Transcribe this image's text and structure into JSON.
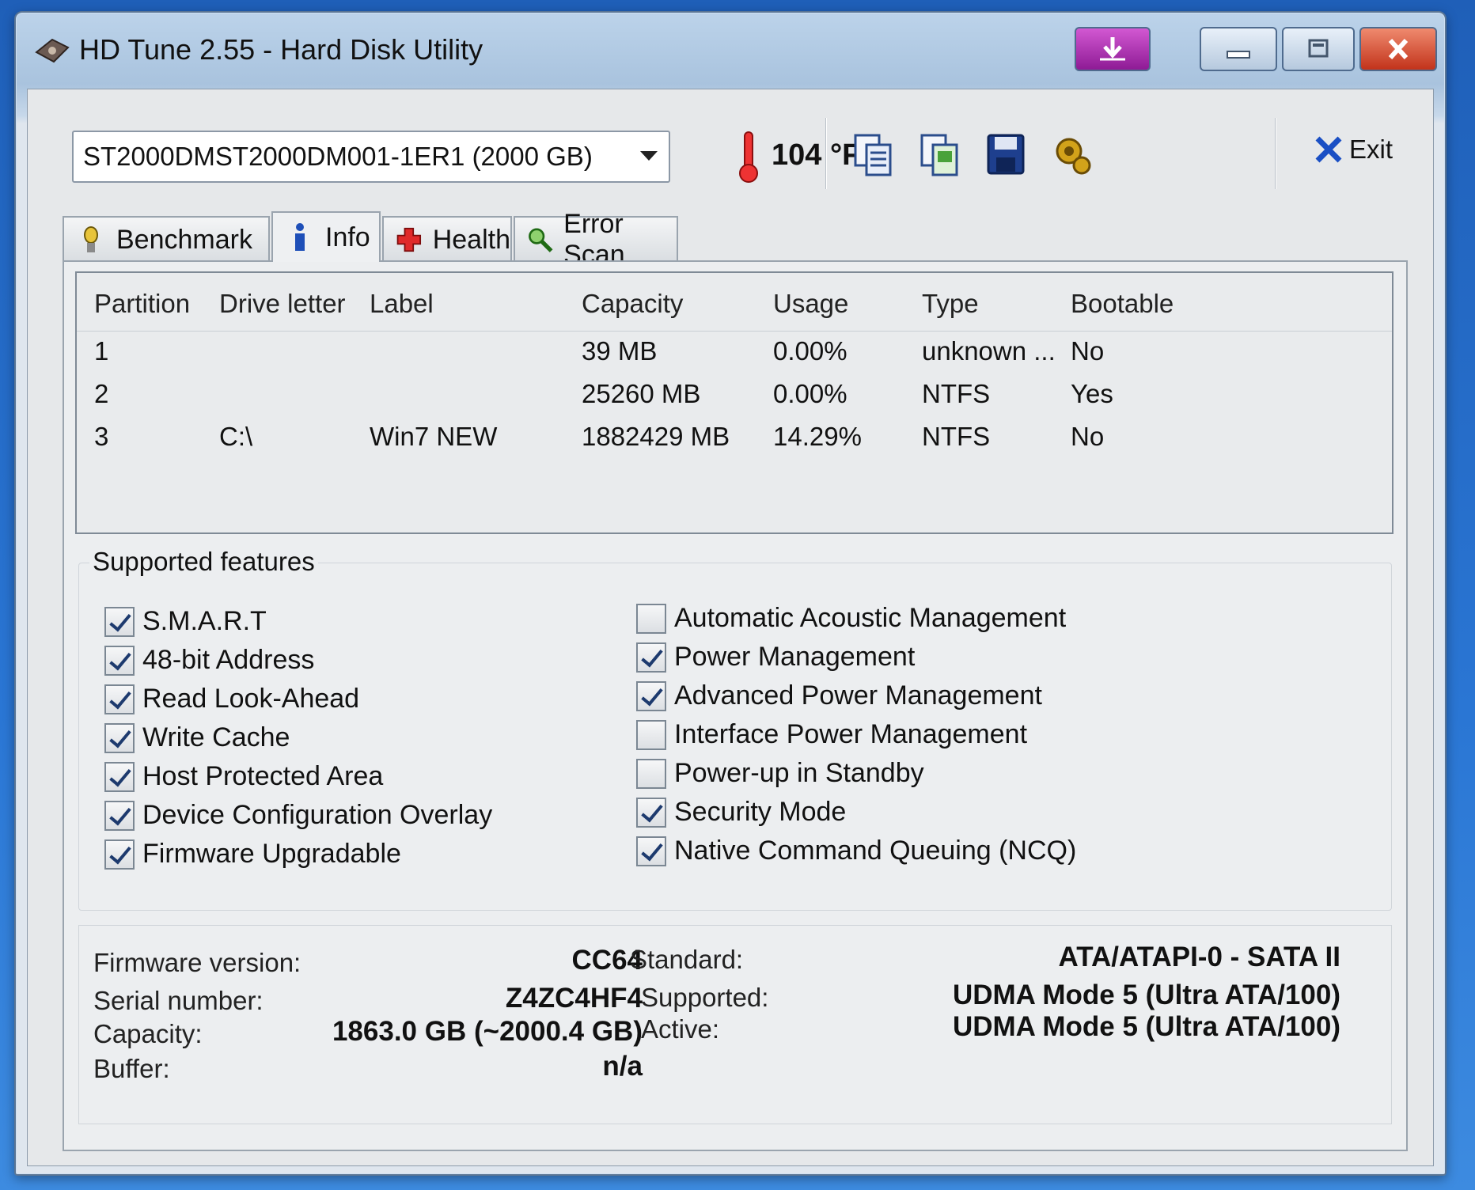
{
  "window": {
    "title": "HD Tune 2.55 - Hard Disk Utility",
    "colors": {
      "close": "#c2331b",
      "download": "#a42aa8",
      "accent": "#1d3a6e"
    }
  },
  "toolbar": {
    "drive": "ST2000DMST2000DM001-1ER1 (2000 GB)",
    "temperature": "104 °F",
    "icons": [
      "copy-text-icon",
      "copy-screenshot-icon",
      "save-icon",
      "options-icon"
    ],
    "exit_label": "Exit"
  },
  "tabs": [
    {
      "label": "Benchmark",
      "icon": "benchmark-icon",
      "active": false
    },
    {
      "label": "Info",
      "icon": "info-icon",
      "active": true
    },
    {
      "label": "Health",
      "icon": "health-icon",
      "active": false
    },
    {
      "label": "Error Scan",
      "icon": "magnifier-icon",
      "active": false
    }
  ],
  "partitions": {
    "headers": [
      "Partition",
      "Drive letter",
      "Label",
      "Capacity",
      "Usage",
      "Type",
      "Bootable"
    ],
    "rows": [
      [
        "1",
        "",
        "",
        "39 MB",
        "0.00%",
        "unknown ...",
        "No"
      ],
      [
        "2",
        "",
        "",
        "25260 MB",
        "0.00%",
        "NTFS",
        "Yes"
      ],
      [
        "3",
        "C:\\",
        "Win7 NEW",
        "1882429 MB",
        "14.29%",
        "NTFS",
        "No"
      ]
    ]
  },
  "features": {
    "title": "Supported features",
    "left": [
      {
        "label": "S.M.A.R.T",
        "checked": true
      },
      {
        "label": "48-bit Address",
        "checked": true
      },
      {
        "label": "Read Look-Ahead",
        "checked": true
      },
      {
        "label": "Write Cache",
        "checked": true
      },
      {
        "label": "Host Protected Area",
        "checked": true
      },
      {
        "label": "Device Configuration Overlay",
        "checked": true
      },
      {
        "label": "Firmware Upgradable",
        "checked": true
      }
    ],
    "right": [
      {
        "label": "Automatic Acoustic Management",
        "checked": false
      },
      {
        "label": "Power Management",
        "checked": true
      },
      {
        "label": "Advanced Power Management",
        "checked": true
      },
      {
        "label": "Interface Power Management",
        "checked": false
      },
      {
        "label": "Power-up in Standby",
        "checked": false
      },
      {
        "label": "Security Mode",
        "checked": true
      },
      {
        "label": "Native Command Queuing (NCQ)",
        "checked": true
      }
    ]
  },
  "details": {
    "firmware_label": "Firmware version:",
    "firmware": "CC64",
    "serial_label": "Serial number:",
    "serial": "Z4ZC4HF4",
    "capacity_label": "Capacity:",
    "capacity": "1863.0 GB (~2000.4 GB)",
    "buffer_label": "Buffer:",
    "buffer": "n/a",
    "standard_label": "Standard:",
    "standard": "ATA/ATAPI-0 - SATA II",
    "supported_label": "Supported:",
    "supported": "UDMA Mode 5 (Ultra ATA/100)",
    "active_label": "Active:",
    "active": "UDMA Mode 5 (Ultra ATA/100)"
  }
}
